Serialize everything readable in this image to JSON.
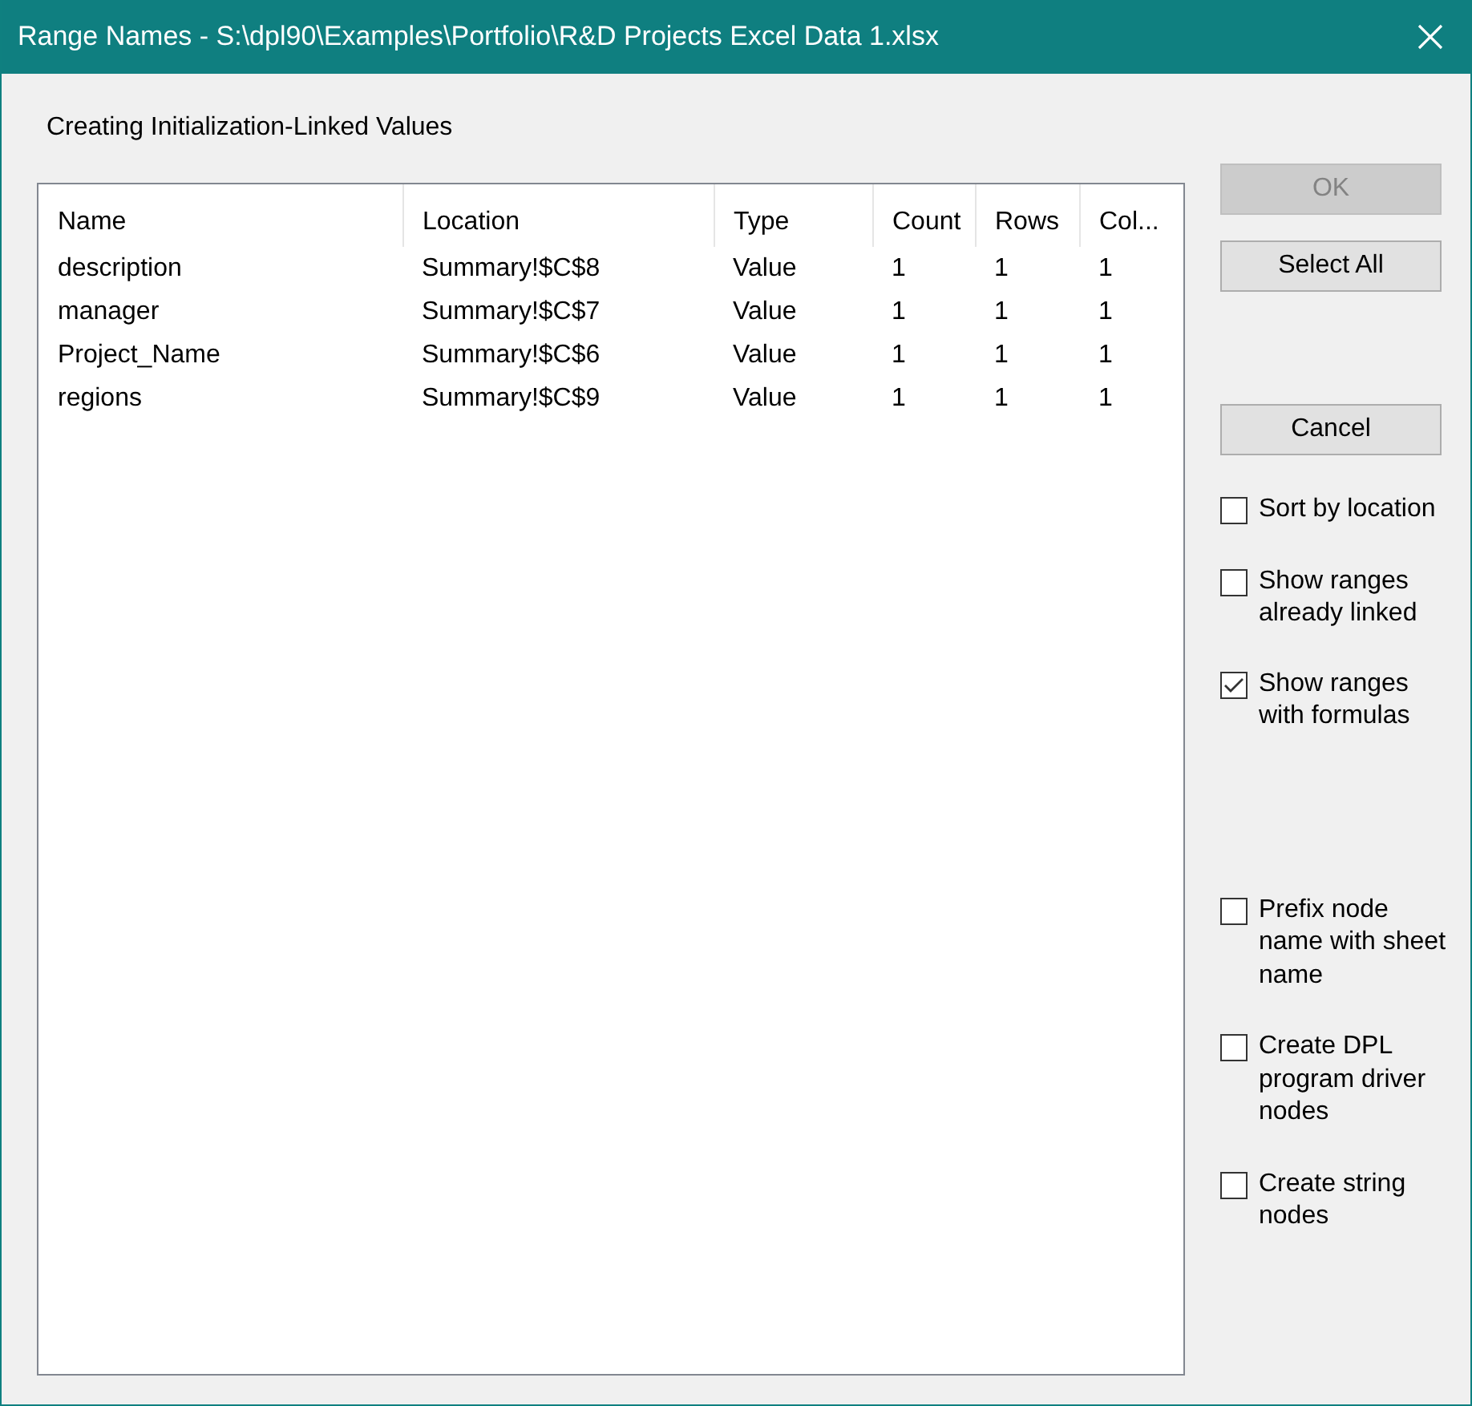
{
  "window": {
    "title": "Range Names - S:\\dpl90\\Examples\\Portfolio\\R&D Projects Excel Data 1.xlsx"
  },
  "heading": "Creating Initialization-Linked Values",
  "table": {
    "columns": [
      "Name",
      "Location",
      "Type",
      "Count",
      "Rows",
      "Col..."
    ],
    "rows": [
      [
        "description",
        "Summary!$C$8",
        "Value",
        "1",
        "1",
        "1"
      ],
      [
        "manager",
        "Summary!$C$7",
        "Value",
        "1",
        "1",
        "1"
      ],
      [
        "Project_Name",
        "Summary!$C$6",
        "Value",
        "1",
        "1",
        "1"
      ],
      [
        "regions",
        "Summary!$C$9",
        "Value",
        "1",
        "1",
        "1"
      ]
    ]
  },
  "buttons": [
    {
      "label": "OK",
      "disabled": true
    },
    {
      "label": "Select All",
      "disabled": false
    },
    {
      "label": "Cancel",
      "disabled": false
    }
  ],
  "checkboxes": [
    {
      "label": "Sort by location",
      "checked": false
    },
    {
      "label": "Show ranges\nalready linked",
      "checked": false
    },
    {
      "label": "Show ranges\nwith formulas",
      "checked": true
    },
    {
      "label": "Prefix node\nname with sheet\nname",
      "checked": false
    },
    {
      "label": "Create DPL\nprogram driver\nnodes",
      "checked": false
    },
    {
      "label": "Create string\nnodes",
      "checked": false
    }
  ]
}
